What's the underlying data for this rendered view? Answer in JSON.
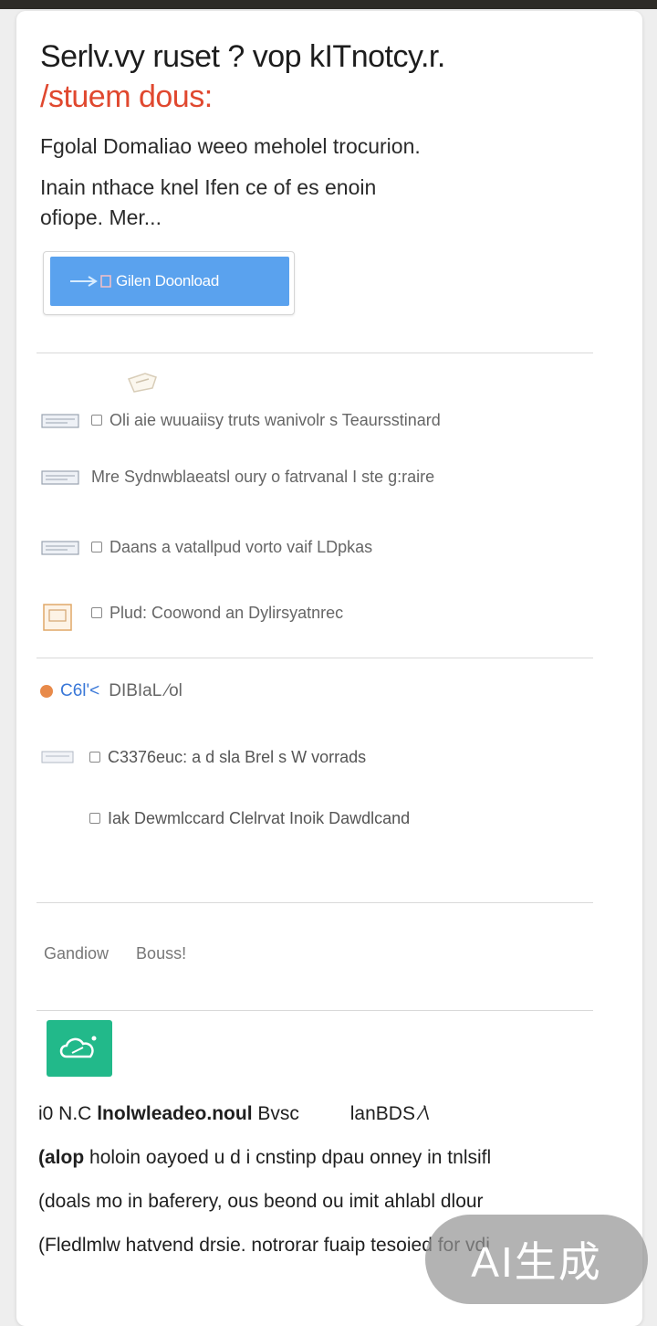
{
  "header": {
    "title": "Serlv.vy ruset ? vop kITnotcy.r.",
    "title_accent": "/stuem dous:",
    "lead": "Fgolal Domaliao weeo meholel trocurion.",
    "description": "Inain nthace knel Ifen ce of es enoin ofiope. Mer..."
  },
  "download": {
    "label": "Gilen Doonload",
    "color": "#5aa2ee"
  },
  "features": [
    {
      "icon": "devices-icon",
      "text": "Oli aie wuuaiisy truts wanivolr s Teaursstinard"
    },
    {
      "icon": "devices-icon",
      "text": "Mre Sydnwblaeatsl oury o fatrvanal I ste g:raire"
    },
    {
      "icon": "devices-icon",
      "text": "Daans a vatallpud vorto vaif LDpkas"
    },
    {
      "icon": "document-icon",
      "text": "Plud: Coowond an Dylirsyatnrec"
    }
  ],
  "versions": {
    "accent": "C6l'<",
    "heading": "DIBIaL ⁄ol",
    "items": [
      {
        "text": "C3376euc: a d sla Brel s W vorrads"
      },
      {
        "text": "Iak Dewmlccard Clelrvat Inoik Dawdlcand"
      }
    ]
  },
  "tabs": [
    "Gandiow",
    "Bouss!"
  ],
  "app": {
    "icon": "cloud-app-icon",
    "icon_color": "#22b98a",
    "line1_prefix": "i0 N.C",
    "line1_bold": "lnolwleadeo.noul",
    "line1_mid": "Bvsc",
    "line1_end": "lanBDS ⁄\\",
    "line2_bold": "(alop",
    "line2_rest": "holoin oayoed u d i cnstinp dpau onney in tnlsifl",
    "line3": "(doals mo in baferery, ous beond ou imit ahlabl dlour",
    "line4": "(Fledlmlw hatvend drsie. notrorar fuaip tesoied for vdi"
  },
  "watermark": "AI生成",
  "colors": {
    "accent_red": "#e0482f",
    "link_blue": "#3a78d8",
    "download_blue": "#5aa2ee",
    "app_green": "#22b98a"
  }
}
